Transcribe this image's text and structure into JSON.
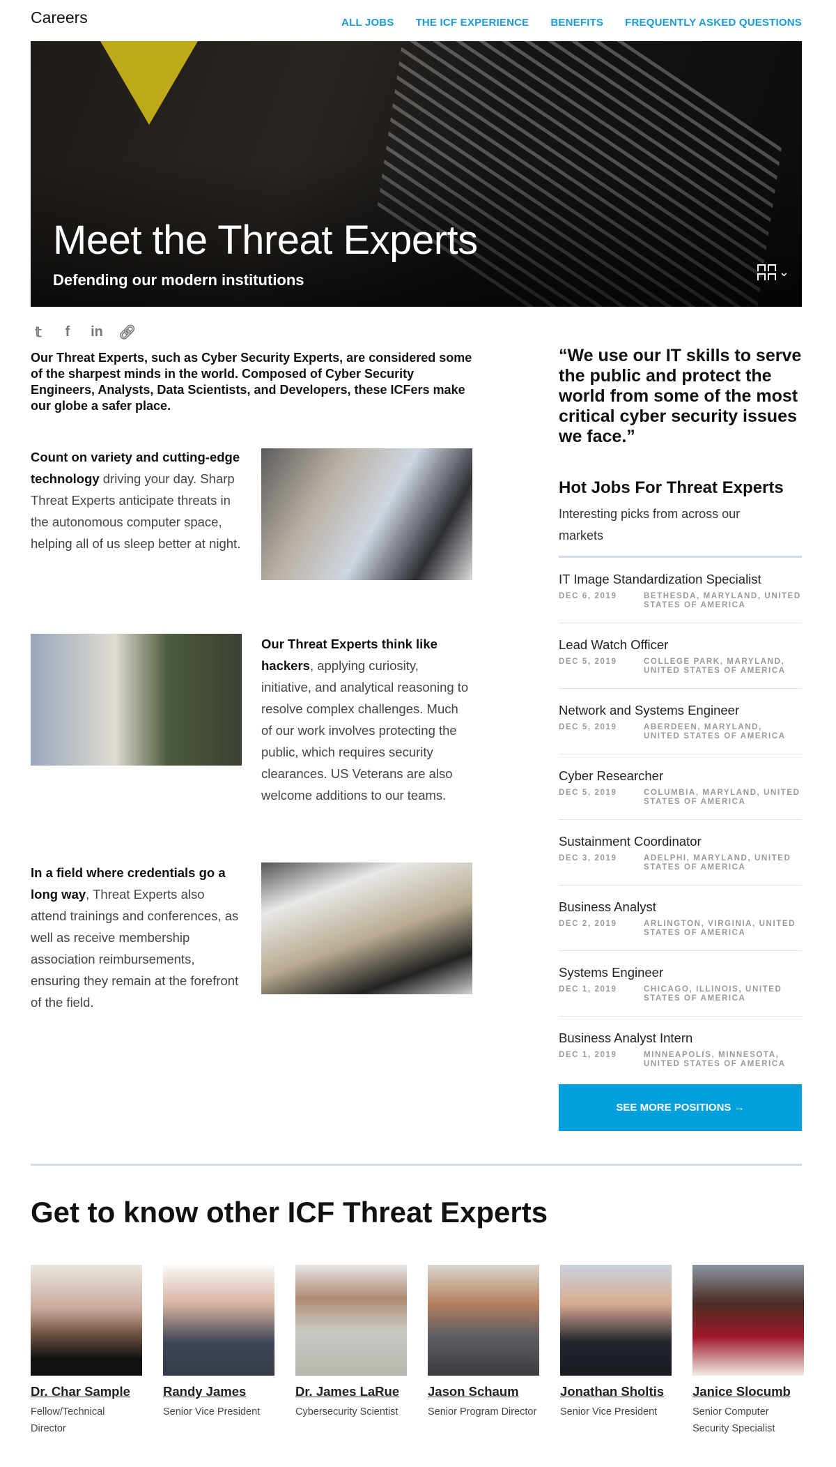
{
  "header": {
    "brand": "Careers",
    "nav": [
      "ALL JOBS",
      "THE ICF EXPERIENCE",
      "BENEFITS",
      "FREQUENTLY ASKED QUESTIONS"
    ]
  },
  "hero": {
    "title": "Meet the Threat Experts",
    "subtitle": "Defending our modern institutions",
    "gallery_icon": "gallery-grid-icon"
  },
  "share": {
    "icons": [
      "twitter-icon",
      "facebook-icon",
      "linkedin-icon",
      "link-icon"
    ]
  },
  "intro": "Our Threat Experts, such as Cyber Security Experts, are considered some of the sharpest minds in the world. Composed of Cyber Security Engineers, Analysts, Data Scientists, and Developers, these ICFers make our globe a safer place.",
  "sections": [
    {
      "bold": "Count on variety and cutting-edge technology",
      "text": " driving your day. Sharp Threat Experts anticipate threats in the autonomous computer space, helping all of us sleep better at night."
    },
    {
      "bold": "Our Threat Experts think like hackers",
      "text": ", applying curiosity, initiative, and analytical reasoning to resolve complex challenges. Much of our work involves protecting the public, which requires security clearances. US Veterans are also welcome additions to our teams."
    },
    {
      "bold": "In a field where credentials go a long way",
      "text": ", Threat Experts also attend trainings and conferences, as well as receive membership association reimbursements, ensuring they remain at the forefront of the field."
    }
  ],
  "quote": "“We use our IT skills to serve the public and protect the world from some of the most critical cyber security issues we face.”",
  "hot_jobs": {
    "title": "Hot Jobs For Threat Experts",
    "subtitle": "Interesting picks from across our markets",
    "jobs": [
      {
        "title": "IT Image Standardization Specialist",
        "date": "DEC 6, 2019",
        "location": "BETHESDA, MARYLAND, UNITED STATES OF AMERICA"
      },
      {
        "title": "Lead Watch Officer",
        "date": "DEC 5, 2019",
        "location": "COLLEGE PARK, MARYLAND, UNITED STATES OF AMERICA"
      },
      {
        "title": "Network and Systems Engineer",
        "date": "DEC 5, 2019",
        "location": "ABERDEEN, MARYLAND, UNITED STATES OF AMERICA"
      },
      {
        "title": "Cyber Researcher",
        "date": "DEC 5, 2019",
        "location": "COLUMBIA, MARYLAND, UNITED STATES OF AMERICA"
      },
      {
        "title": "Sustainment Coordinator",
        "date": "DEC 3, 2019",
        "location": "ADELPHI, MARYLAND, UNITED STATES OF AMERICA"
      },
      {
        "title": "Business Analyst",
        "date": "DEC 2, 2019",
        "location": "ARLINGTON, VIRGINIA, UNITED STATES OF AMERICA"
      },
      {
        "title": "Systems Engineer",
        "date": "DEC 1, 2019",
        "location": "CHICAGO, ILLINOIS, UNITED STATES OF AMERICA"
      },
      {
        "title": "Business Analyst Intern",
        "date": "DEC 1, 2019",
        "location": "MINNEAPOLIS, MINNESOTA, UNITED STATES OF AMERICA"
      }
    ],
    "button": "SEE MORE POSITIONS →"
  },
  "experts": {
    "title": "Get to know other ICF Threat Experts",
    "people": [
      {
        "name": "Dr. Char Sample",
        "role": "Fellow/Technical Director"
      },
      {
        "name": "Randy James",
        "role": "Senior Vice President"
      },
      {
        "name": "Dr. James LaRue",
        "role": "Cybersecurity Scientist"
      },
      {
        "name": "Jason Schaum",
        "role": "Senior Program Director"
      },
      {
        "name": "Jonathan Sholtis",
        "role": "Senior Vice President"
      },
      {
        "name": "Janice Slocumb",
        "role": "Senior Computer Security Specialist"
      }
    ]
  },
  "colors": {
    "accent": "#1b9ad6",
    "button": "#00a0de"
  }
}
